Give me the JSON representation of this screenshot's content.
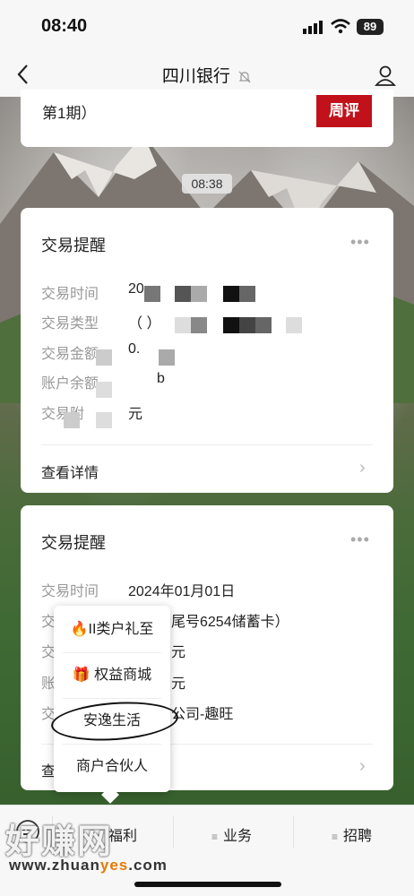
{
  "status_bar": {
    "time": "08:40",
    "battery": "89"
  },
  "nav": {
    "title": "四川银行"
  },
  "prev_card": {
    "text": "第1期）",
    "tag": "周评"
  },
  "timestamp": "08:38",
  "card1": {
    "title": "交易提醒",
    "more": "•••",
    "rows": [
      {
        "label": "交易时间",
        "value": "20"
      },
      {
        "label": "交易类型",
        "value": "（             ）"
      },
      {
        "label": "交易金额",
        "value": "0."
      },
      {
        "label": "账户余额",
        "value": "b"
      },
      {
        "label": "交易附",
        "value": "元"
      }
    ],
    "detail": "查看详情"
  },
  "card2": {
    "title": "交易提醒",
    "more": "•••",
    "rows": [
      {
        "label": "交易时间",
        "value": "2024年01月01日"
      },
      {
        "label": "交",
        "value": "尾号6254储蓄卡）"
      },
      {
        "label": "交",
        "value": "元"
      },
      {
        "label": "账",
        "value": "元"
      },
      {
        "label": "交",
        "value": "公司-趣旺"
      }
    ],
    "detail": "查"
  },
  "popup": {
    "items": [
      {
        "label": "🔥II类户礼至"
      },
      {
        "label": "🎁 权益商城"
      },
      {
        "label": "安逸生活"
      },
      {
        "label": "商户合伙人"
      }
    ]
  },
  "tabbar": {
    "tabs": [
      {
        "label": "福利"
      },
      {
        "label": "业务"
      },
      {
        "label": "招聘"
      }
    ]
  },
  "watermark": {
    "main": "好赚网",
    "url_a": "www.zhuan",
    "url_b": "yes",
    "url_c": ".com"
  }
}
